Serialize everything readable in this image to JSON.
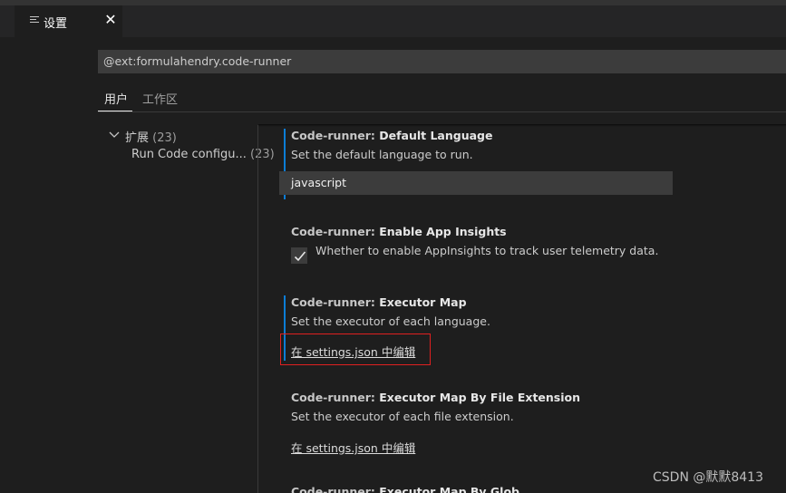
{
  "tab": {
    "label": "设置",
    "close": "✕"
  },
  "search": {
    "value": "@ext:formulahendry.code-runner"
  },
  "scopes": {
    "user": "用户",
    "workspace": "工作区"
  },
  "toc": {
    "group_label": "扩展",
    "group_count": "(23)",
    "item_label": "Run Code configu...",
    "item_count": "(23)"
  },
  "settings": [
    {
      "category": "Code-runner: ",
      "name": "Default Language",
      "description": "Set the default language to run.",
      "value": "javascript"
    },
    {
      "category": "Code-runner: ",
      "name": "Enable App Insights",
      "description": "Whether to enable AppInsights to track user telemetry data.",
      "checked": true
    },
    {
      "category": "Code-runner: ",
      "name": "Executor Map",
      "description": "Set the executor of each language.",
      "link": "在 settings.json 中编辑"
    },
    {
      "category": "Code-runner: ",
      "name": "Executor Map By File Extension",
      "description": "Set the executor of each file extension.",
      "link": "在 settings.json 中编辑"
    },
    {
      "category": "Code-runner: ",
      "name": "Executor Map By Glob"
    }
  ],
  "watermark": "CSDN @默默8413",
  "colors": {
    "accent_bar": "#0c7dd6",
    "highlight_box": "#e02020",
    "background": "#1e1e1e"
  }
}
